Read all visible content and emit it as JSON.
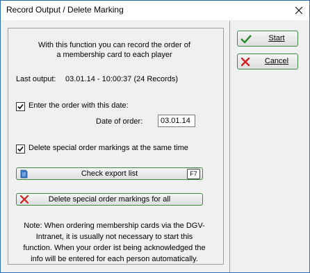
{
  "window": {
    "title": "Record Output / Delete Marking"
  },
  "intro": {
    "line1": "With this function you can record the order of",
    "line2": "a membership card to each player"
  },
  "last_output": {
    "label": "Last output:",
    "value": "03.01.14 - 10:00:37 (24 Records)"
  },
  "order_date": {
    "checkbox_label": "Enter the order with this date:",
    "checked": true,
    "field_label": "Date of order:",
    "field_value": "03.01.14"
  },
  "delete_markings": {
    "checkbox_label": "Delete special order markings at the same time",
    "checked": true
  },
  "buttons": {
    "check_export": "Check export list",
    "check_export_key": "F7",
    "delete_all": "Delete special order markings for all",
    "start": "Start",
    "cancel": "Cancel"
  },
  "note": {
    "line1": "Note: When ordering membership cards via the DGV-",
    "line2": "Intranet, it is usually not necessary to start this",
    "line3": "function. When your order ist being acknowledged the",
    "line4": "info will be entered for each person automatically."
  },
  "colors": {
    "window_border": "#2a6ab8",
    "button_border": "#3e8a3e",
    "check_icon": "#2e8b2e",
    "cancel_icon": "#d42020",
    "doc_icon": "#3a78c8"
  },
  "icons": [
    "close-icon",
    "checkbox-check-icon",
    "document-icon",
    "red-x-icon",
    "green-check-icon"
  ]
}
